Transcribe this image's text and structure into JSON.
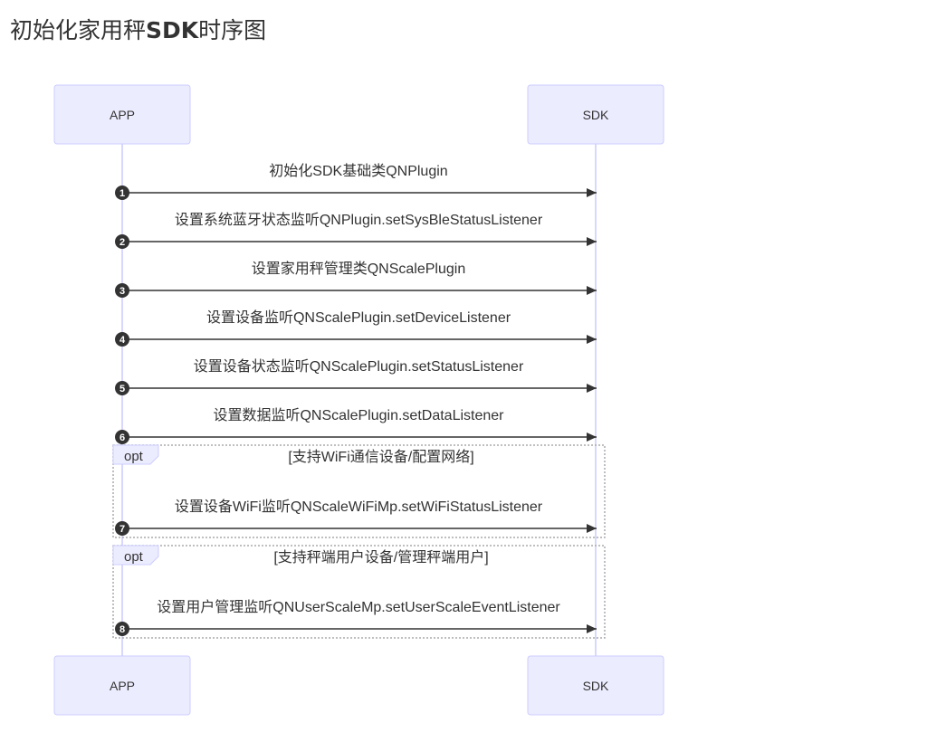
{
  "title": {
    "prefix": "初始化家用秤",
    "bold": "SDK",
    "suffix": "时序图"
  },
  "participants": {
    "app": "APP",
    "sdk": "SDK"
  },
  "messages": [
    {
      "num": "1",
      "text": "初始化SDK基础类QNPlugin"
    },
    {
      "num": "2",
      "text": "设置系统蓝牙状态监听QNPlugin.setSysBleStatusListener"
    },
    {
      "num": "3",
      "text": "设置家用秤管理类QNScalePlugin"
    },
    {
      "num": "4",
      "text": "设置设备监听QNScalePlugin.setDeviceListener"
    },
    {
      "num": "5",
      "text": "设置设备状态监听QNScalePlugin.setStatusListener"
    },
    {
      "num": "6",
      "text": "设置数据监听QNScalePlugin.setDataListener"
    },
    {
      "num": "7",
      "text": "设置设备WiFi监听QNScaleWiFiMp.setWiFiStatusListener"
    },
    {
      "num": "8",
      "text": "设置用户管理监听QNUserScaleMp.setUserScaleEventListener"
    }
  ],
  "fragments": [
    {
      "kind": "opt",
      "condition": "[支持WiFi通信设备/配置网络]"
    },
    {
      "kind": "opt",
      "condition": "[支持秤端用户设备/管理秤端用户]"
    }
  ],
  "colors": {
    "actor_fill": "#ECECFF",
    "actor_stroke": "#CCCCFF",
    "lifeline": "#CCCCFF",
    "arrow": "#333333",
    "sequence_number_fill": "#333333",
    "fragment_border": "#AAAAAA"
  }
}
